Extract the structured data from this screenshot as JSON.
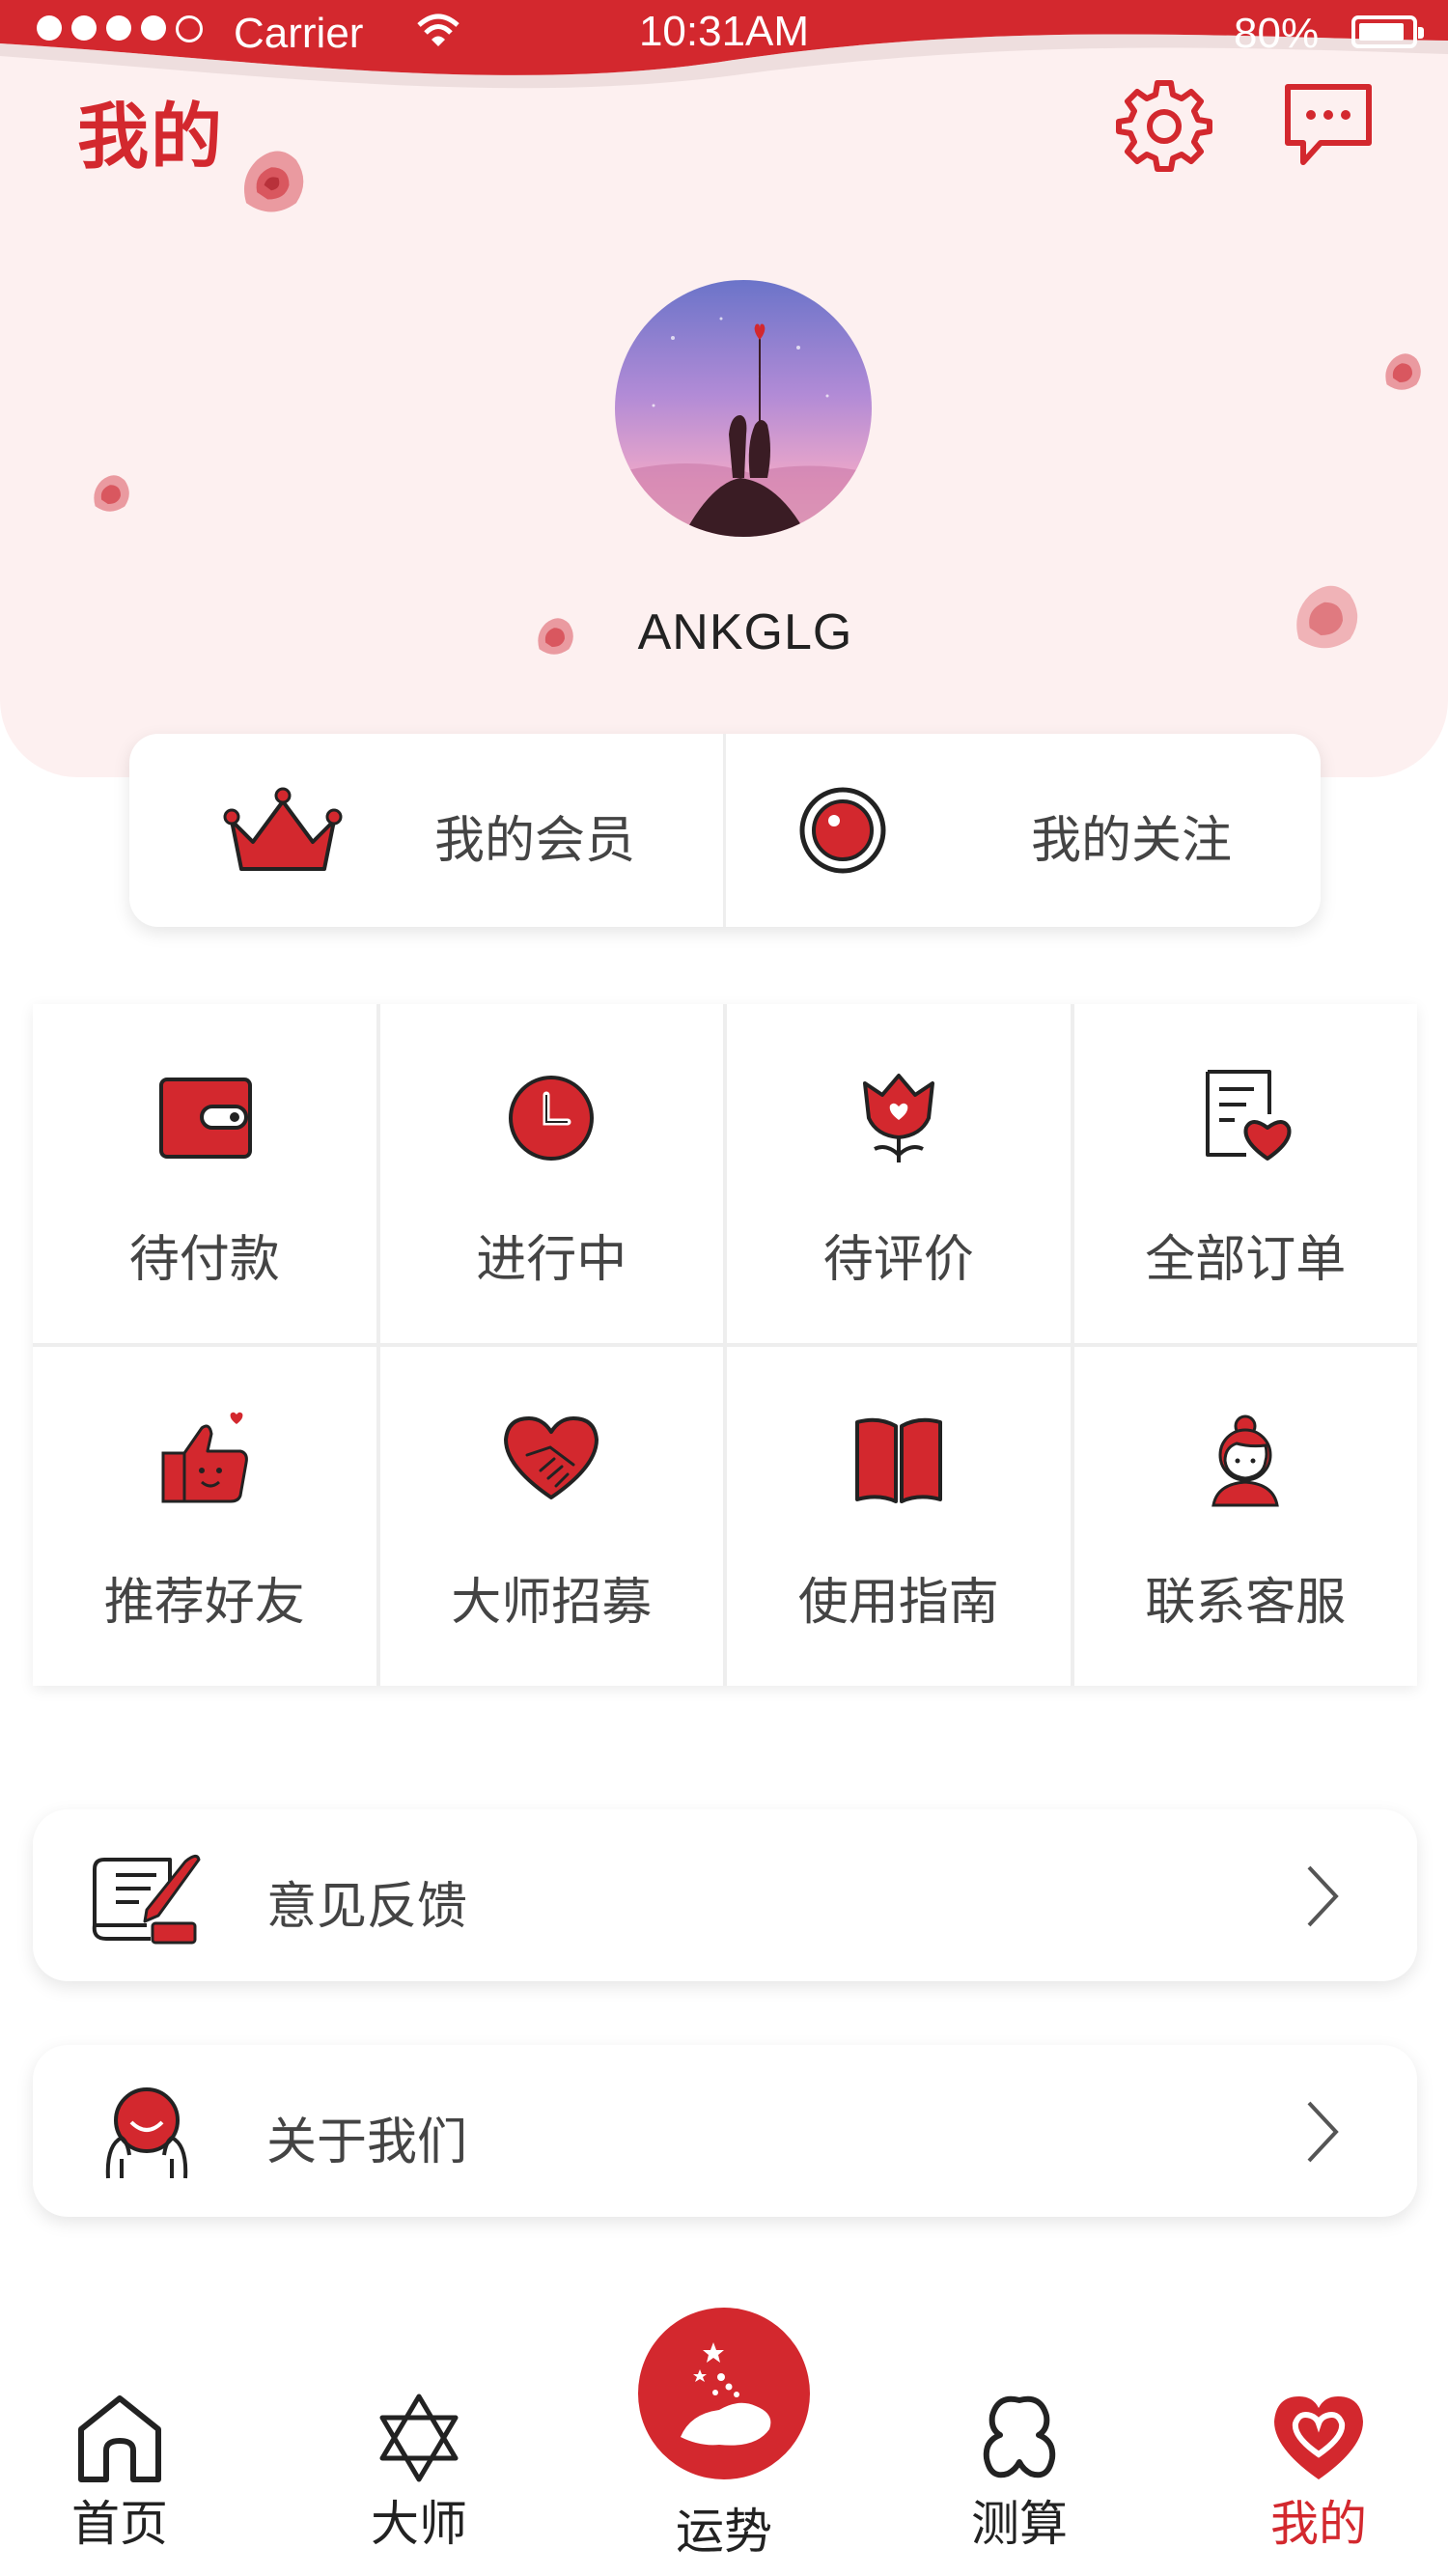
{
  "status_bar": {
    "carrier": "Carrier",
    "time": "10:31AM",
    "battery": "80%"
  },
  "header": {
    "title": "我的"
  },
  "profile": {
    "username": "ANKGLG"
  },
  "member_card": {
    "vip_label": "我的会员",
    "follow_label": "我的关注"
  },
  "grid": {
    "items": [
      {
        "label": "待付款",
        "icon": "wallet-icon"
      },
      {
        "label": "进行中",
        "icon": "clock-icon"
      },
      {
        "label": "待评价",
        "icon": "tulip-heart-icon"
      },
      {
        "label": "全部订单",
        "icon": "order-list-icon"
      },
      {
        "label": "推荐好友",
        "icon": "thumbs-up-icon"
      },
      {
        "label": "大师招募",
        "icon": "handshake-heart-icon"
      },
      {
        "label": "使用指南",
        "icon": "book-icon"
      },
      {
        "label": "联系客服",
        "icon": "customer-service-icon"
      }
    ]
  },
  "list": {
    "feedback_label": "意见反馈",
    "about_label": "关于我们"
  },
  "tabbar": {
    "items": [
      {
        "label": "首页",
        "icon": "home-icon"
      },
      {
        "label": "大师",
        "icon": "hexagram-icon"
      },
      {
        "label": "运势",
        "icon": "fortune-hand-icon"
      },
      {
        "label": "测算",
        "icon": "clover-icon"
      },
      {
        "label": "我的",
        "icon": "heart-icon"
      }
    ],
    "active_index": 4
  },
  "colors": {
    "accent": "#d3282e",
    "hero_bg": "#fdf0f0"
  }
}
